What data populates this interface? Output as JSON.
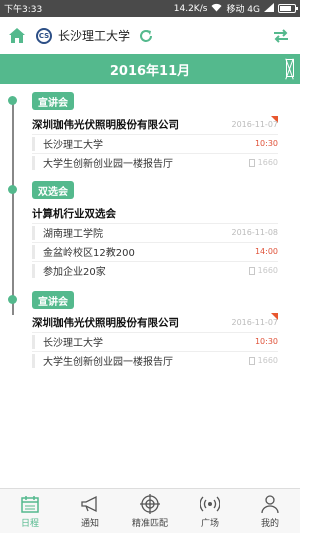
{
  "status_bar": {
    "time": "下午3:33",
    "speed": "14.2K/s",
    "carrier": "移动 4G"
  },
  "top_bar": {
    "school": "长沙理工大学",
    "logo_text": "CS"
  },
  "month_header": {
    "title": "2016年11月"
  },
  "events": [
    {
      "badge": "宣讲会",
      "title": "深圳珈伟光伏照明股份有限公司",
      "date": "2016-11-07",
      "flagged": true,
      "rows": [
        {
          "label": "长沙理工大学",
          "right": "10:30",
          "right_type": "red"
        },
        {
          "label": "大学生创新创业园一楼报告厅",
          "right": "1660",
          "right_type": "count"
        }
      ]
    },
    {
      "badge": "双选会",
      "title": "计算机行业双选会",
      "date": "",
      "flagged": false,
      "rows": [
        {
          "label": "湖南理工学院",
          "right": "2016-11-08",
          "right_type": "gray"
        },
        {
          "label": "金盆岭校区12教200",
          "right": "14:00",
          "right_type": "red"
        },
        {
          "label": "参加企业20家",
          "right": "1660",
          "right_type": "count"
        }
      ]
    },
    {
      "badge": "宣讲会",
      "title": "深圳珈伟光伏照明股份有限公司",
      "date": "2016-11-07",
      "flagged": true,
      "rows": [
        {
          "label": "长沙理工大学",
          "right": "10:30",
          "right_type": "red"
        },
        {
          "label": "大学生创新创业园一楼报告厅",
          "right": "1660",
          "right_type": "count"
        }
      ]
    }
  ],
  "bottom_nav": [
    {
      "label": "日程",
      "icon": "calendar-icon",
      "active": true
    },
    {
      "label": "通知",
      "icon": "megaphone-icon",
      "active": false
    },
    {
      "label": "精准匹配",
      "icon": "target-icon",
      "active": false
    },
    {
      "label": "广场",
      "icon": "broadcast-icon",
      "active": false
    },
    {
      "label": "我的",
      "icon": "user-icon",
      "active": false
    }
  ],
  "colors": {
    "accent": "#54b98d",
    "time_red": "#e0533a",
    "status_bar": "#4a4a4a"
  }
}
